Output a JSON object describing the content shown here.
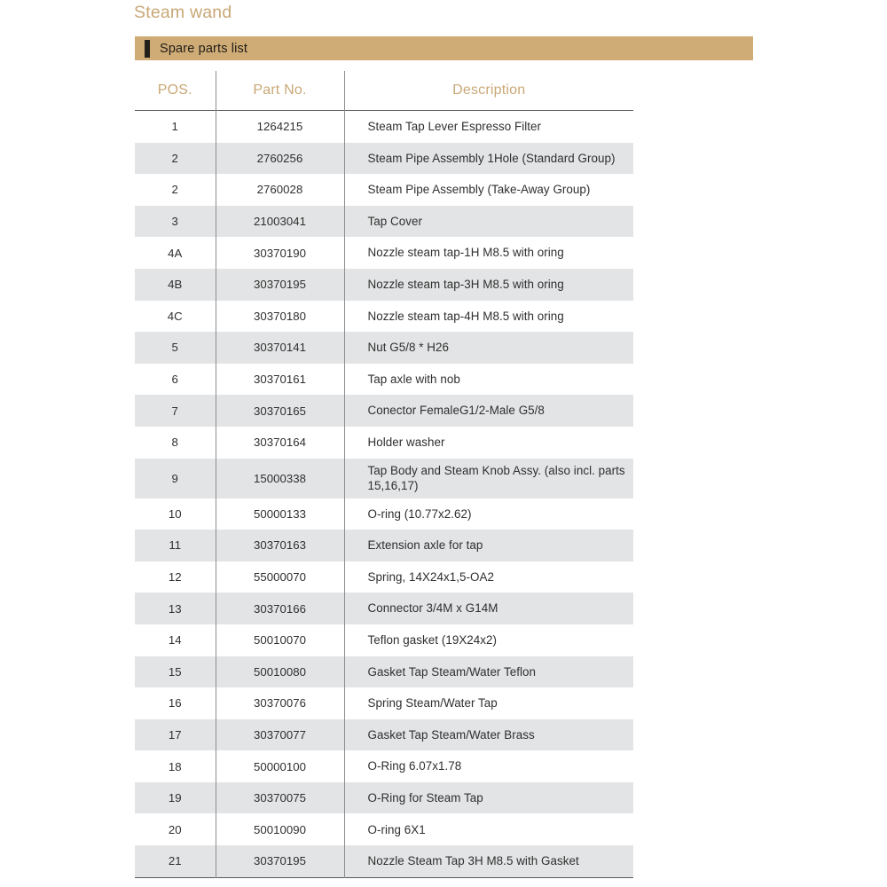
{
  "page": {
    "title": "Steam wand"
  },
  "banner": {
    "label": "Spare parts list",
    "background_color": "#cfab75",
    "mark_color": "#231f1a"
  },
  "theme": {
    "accent_color": "#c9a876",
    "stripe_color": "#e3e4e5",
    "rule_color": "#5a5a5a",
    "divider_color": "#8d8d8d",
    "text_color": "#2f2f2f"
  },
  "table": {
    "columns": [
      {
        "key": "pos",
        "label": "POS."
      },
      {
        "key": "part",
        "label": "Part No."
      },
      {
        "key": "desc",
        "label": "Description"
      }
    ],
    "rows": [
      {
        "pos": "1",
        "part": "1264215",
        "desc": "Steam Tap Lever Espresso Filter"
      },
      {
        "pos": "2",
        "part": "2760256",
        "desc": "Steam Pipe Assembly 1Hole (Standard Group)"
      },
      {
        "pos": "2",
        "part": "2760028",
        "desc": "Steam Pipe Assembly (Take-Away Group)"
      },
      {
        "pos": "3",
        "part": "21003041",
        "desc": "Tap Cover"
      },
      {
        "pos": "4A",
        "part": "30370190",
        "desc": "Nozzle steam tap-1H M8.5 with oring"
      },
      {
        "pos": "4B",
        "part": "30370195",
        "desc": "Nozzle steam tap-3H M8.5 with oring"
      },
      {
        "pos": "4C",
        "part": "30370180",
        "desc": "Nozzle steam tap-4H M8.5 with oring"
      },
      {
        "pos": "5",
        "part": "30370141",
        "desc": "Nut G5/8 * H26"
      },
      {
        "pos": "6",
        "part": "30370161",
        "desc": "Tap axle with nob"
      },
      {
        "pos": "7",
        "part": "30370165",
        "desc": "Conector FemaleG1/2-Male G5/8"
      },
      {
        "pos": "8",
        "part": "30370164",
        "desc": "Holder washer"
      },
      {
        "pos": "9",
        "part": "15000338",
        "desc": "Tap Body and Steam Knob Assy. (also incl. parts 15,16,17)"
      },
      {
        "pos": "10",
        "part": "50000133",
        "desc": "O-ring (10.77x2.62)"
      },
      {
        "pos": "11",
        "part": "30370163",
        "desc": "Extension axle for tap"
      },
      {
        "pos": "12",
        "part": "55000070",
        "desc": "Spring, 14X24x1,5-OA2"
      },
      {
        "pos": "13",
        "part": "30370166",
        "desc": "Connector 3/4M x G14M"
      },
      {
        "pos": "14",
        "part": "50010070",
        "desc": "Teflon gasket (19X24x2)"
      },
      {
        "pos": "15",
        "part": "50010080",
        "desc": "Gasket Tap Steam/Water Teflon"
      },
      {
        "pos": "16",
        "part": "30370076",
        "desc": "Spring Steam/Water Tap"
      },
      {
        "pos": "17",
        "part": "30370077",
        "desc": "Gasket Tap Steam/Water Brass"
      },
      {
        "pos": "18",
        "part": "50000100",
        "desc": "O-Ring 6.07x1.78"
      },
      {
        "pos": "19",
        "part": "30370075",
        "desc": "O-Ring for Steam Tap"
      },
      {
        "pos": "20",
        "part": "50010090",
        "desc": "O-ring 6X1"
      },
      {
        "pos": "21",
        "part": "30370195",
        "desc": "Nozzle Steam Tap 3H M8.5 with Gasket"
      }
    ]
  }
}
